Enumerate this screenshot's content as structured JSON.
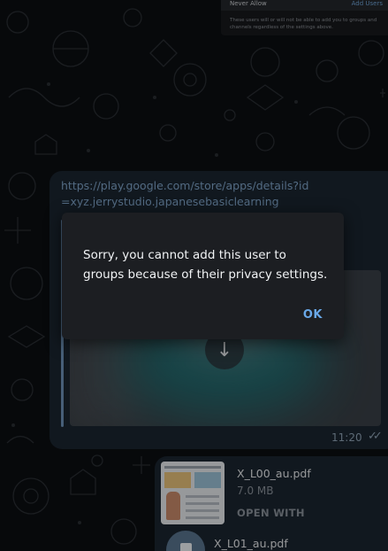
{
  "forwarded_shot": {
    "never_allow": "Never Allow",
    "add_users": "Add Users",
    "info": "These users will or will not be able to add you to groups and channels regardless of the settings above."
  },
  "link_message": {
    "url": "https://play.google.com/store/apps/details?id=xyz.jerrystudio.japanesebasiclearning",
    "time": "11:20",
    "status_icon": "double-check-icon"
  },
  "file_messages": [
    {
      "name": "X_L00_au.pdf",
      "size": "7.0 MB",
      "action": "OPEN WITH"
    },
    {
      "name": "X_L01_au.pdf"
    }
  ],
  "dialog": {
    "message": "Sorry, you cannot add this user to groups because of their privacy settings.",
    "ok_label": "OK"
  },
  "colors": {
    "accent": "#69a8e8",
    "bubble": "#1b2530",
    "dialog_bg": "#1c1e22"
  }
}
